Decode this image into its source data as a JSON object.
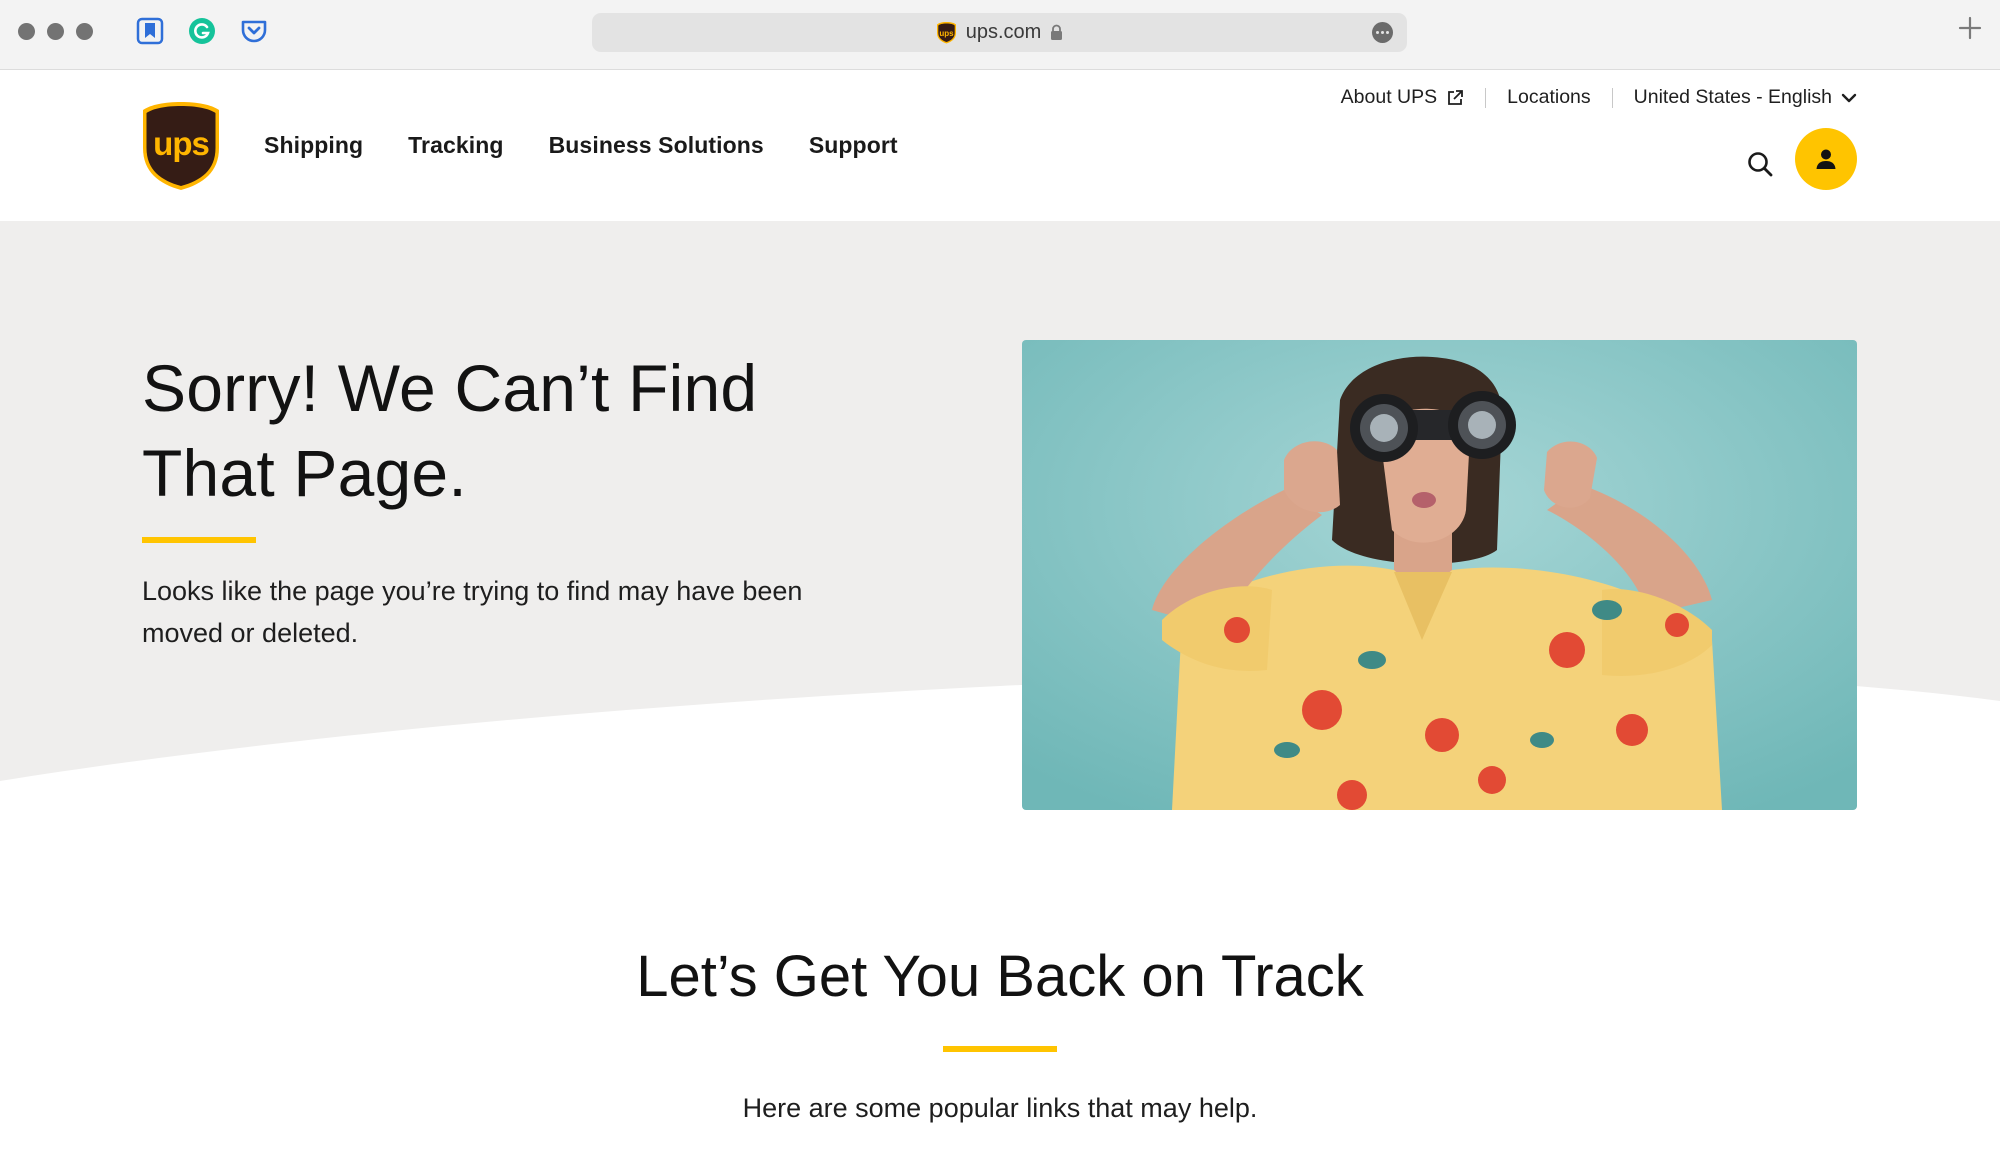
{
  "browser": {
    "url": "ups.com",
    "icons": [
      "bookmarks-icon",
      "grammarly-icon",
      "pocket-icon",
      "lock-icon",
      "more-icon",
      "new-tab-icon"
    ]
  },
  "header": {
    "logo_text": "ups",
    "nav": [
      "Shipping",
      "Tracking",
      "Business Solutions",
      "Support"
    ],
    "utility": {
      "about": "About UPS",
      "locations": "Locations",
      "locale": "United States - English"
    }
  },
  "hero": {
    "title_line1": "Sorry! We Can’t Find",
    "title_line2": "That Page.",
    "body_line1": "Looks like the page you’re trying to find may have been",
    "body_line2": "moved or deleted."
  },
  "section": {
    "title": "Let’s Get You Back on Track",
    "subtitle": "Here are some popular links that may help."
  },
  "colors": {
    "accent_yellow": "#ffc400",
    "brand_brown": "#351c15",
    "hero_gray": "#efeeed",
    "photo_teal": "#7dc1c1"
  }
}
